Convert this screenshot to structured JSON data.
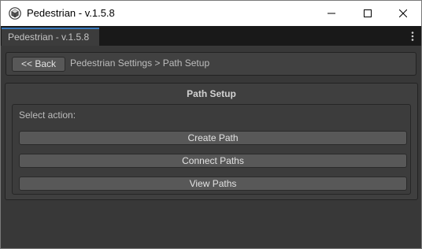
{
  "window": {
    "title": "Pedestrian - v.1.5.8",
    "app_icon": "unity-cube-icon",
    "controls": [
      "minimize-icon",
      "maximize-icon",
      "close-icon"
    ]
  },
  "tabbar": {
    "tab_label": "Pedestrian - v.1.5.8",
    "menu_icon": "kebab-menu-icon",
    "accent_color": "#3a79bb"
  },
  "breadcrumb": {
    "back_label": "<< Back",
    "path_text": "Pedestrian Settings > Path Setup"
  },
  "panel": {
    "title": "Path Setup",
    "select_label": "Select action:",
    "actions": [
      {
        "label": "Create Path"
      },
      {
        "label": "Connect Paths"
      },
      {
        "label": "View Paths"
      }
    ]
  },
  "colors": {
    "editor_background": "#383838",
    "button_background": "#585858",
    "tabbar_background": "#191919",
    "titlebar_background": "#ffffff"
  }
}
